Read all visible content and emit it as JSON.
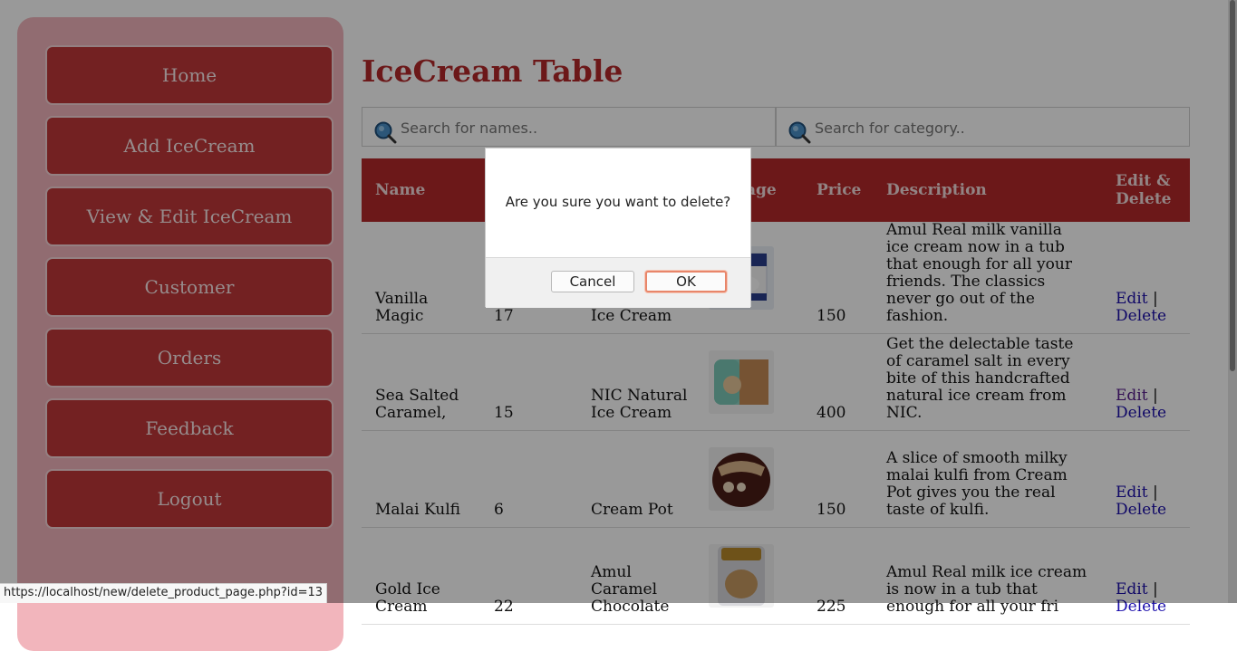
{
  "sidebar": {
    "items": [
      {
        "label": "Home"
      },
      {
        "label": "Add IceCream"
      },
      {
        "label": "View & Edit IceCream"
      },
      {
        "label": "Customer"
      },
      {
        "label": "Orders"
      },
      {
        "label": "Feedback"
      },
      {
        "label": "Logout"
      }
    ]
  },
  "main": {
    "title": "IceCream Table",
    "search_names": {
      "placeholder": "Search for names.."
    },
    "search_category": {
      "placeholder": "Search for category.."
    },
    "table": {
      "headers": {
        "name": "Name",
        "image": "Image",
        "price": "Price",
        "description": "Description",
        "edit_delete": "Edit & Delete"
      },
      "rows": [
        {
          "name": "Vanilla Magic",
          "qty": "17",
          "brand": "Amul Real Ice Cream",
          "price": "150",
          "description": "Amul Real milk vanilla ice cream now in a tub that enough for all your friends. The classics never go out of the fashion.",
          "edit": "Edit",
          "sep": "|",
          "delete": "Delete"
        },
        {
          "name": "Sea Salted Caramel,",
          "qty": "15",
          "brand": "NIC Natural Ice Cream",
          "price": "400",
          "description": "Get the delectable taste of caramel salt in every bite of this handcrafted natural ice cream from NIC.",
          "edit": "Edit",
          "sep": "|",
          "delete": "Delete"
        },
        {
          "name": "Malai Kulfi",
          "qty": "6",
          "brand": "Cream Pot",
          "price": "150",
          "description": "A slice of smooth milky malai kulfi from Cream Pot gives you the real taste of kulfi.",
          "edit": "Edit",
          "sep": "|",
          "delete": "Delete"
        },
        {
          "name": "Gold Ice Cream",
          "qty": "22",
          "brand": "Amul Caramel Chocolate",
          "price": "225",
          "description": "Amul Real milk ice cream is now in a tub that enough for all your fri",
          "edit": "Edit",
          "sep": "|",
          "delete": "Delete"
        }
      ]
    }
  },
  "dialog": {
    "message": "Are you sure you want to delete?",
    "cancel_label": "Cancel",
    "ok_label": "OK"
  },
  "status_bar": {
    "url": "https://localhost/new/delete_product_page.php?id=13"
  },
  "colors": {
    "accent": "#b5292b",
    "sidebar_bg": "#f2b5bc",
    "nav_button": "#c0373a"
  }
}
